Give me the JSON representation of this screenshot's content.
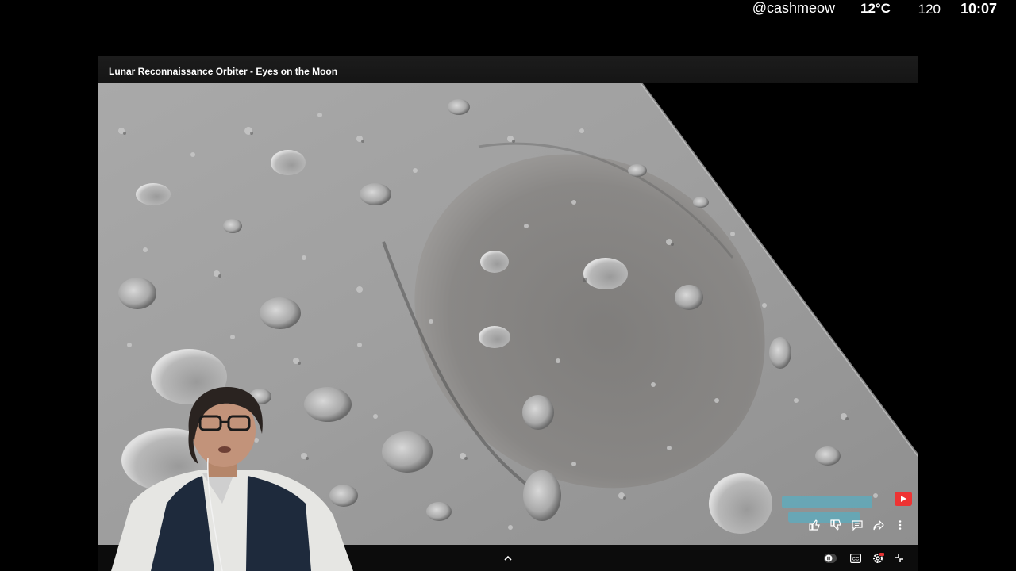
{
  "status": {
    "handle": "@cashmeow",
    "temperature": "12°C",
    "count": "120",
    "time": "10:07"
  },
  "player": {
    "title": "Lunar Reconnaissance Orbiter - Eyes on the Moon"
  },
  "icons": {
    "yt_badge": "youtube-play-icon",
    "actions": [
      "thumbs-up-icon",
      "thumbs-down-icon",
      "comment-icon",
      "share-icon",
      "more-vert-icon"
    ],
    "controls": [
      "chevron-up-icon",
      "pause-toggle-icon",
      "captions-icon",
      "settings-icon",
      "exit-fullscreen-icon"
    ]
  },
  "colors": {
    "background": "#000000",
    "accent": "#e33333"
  }
}
